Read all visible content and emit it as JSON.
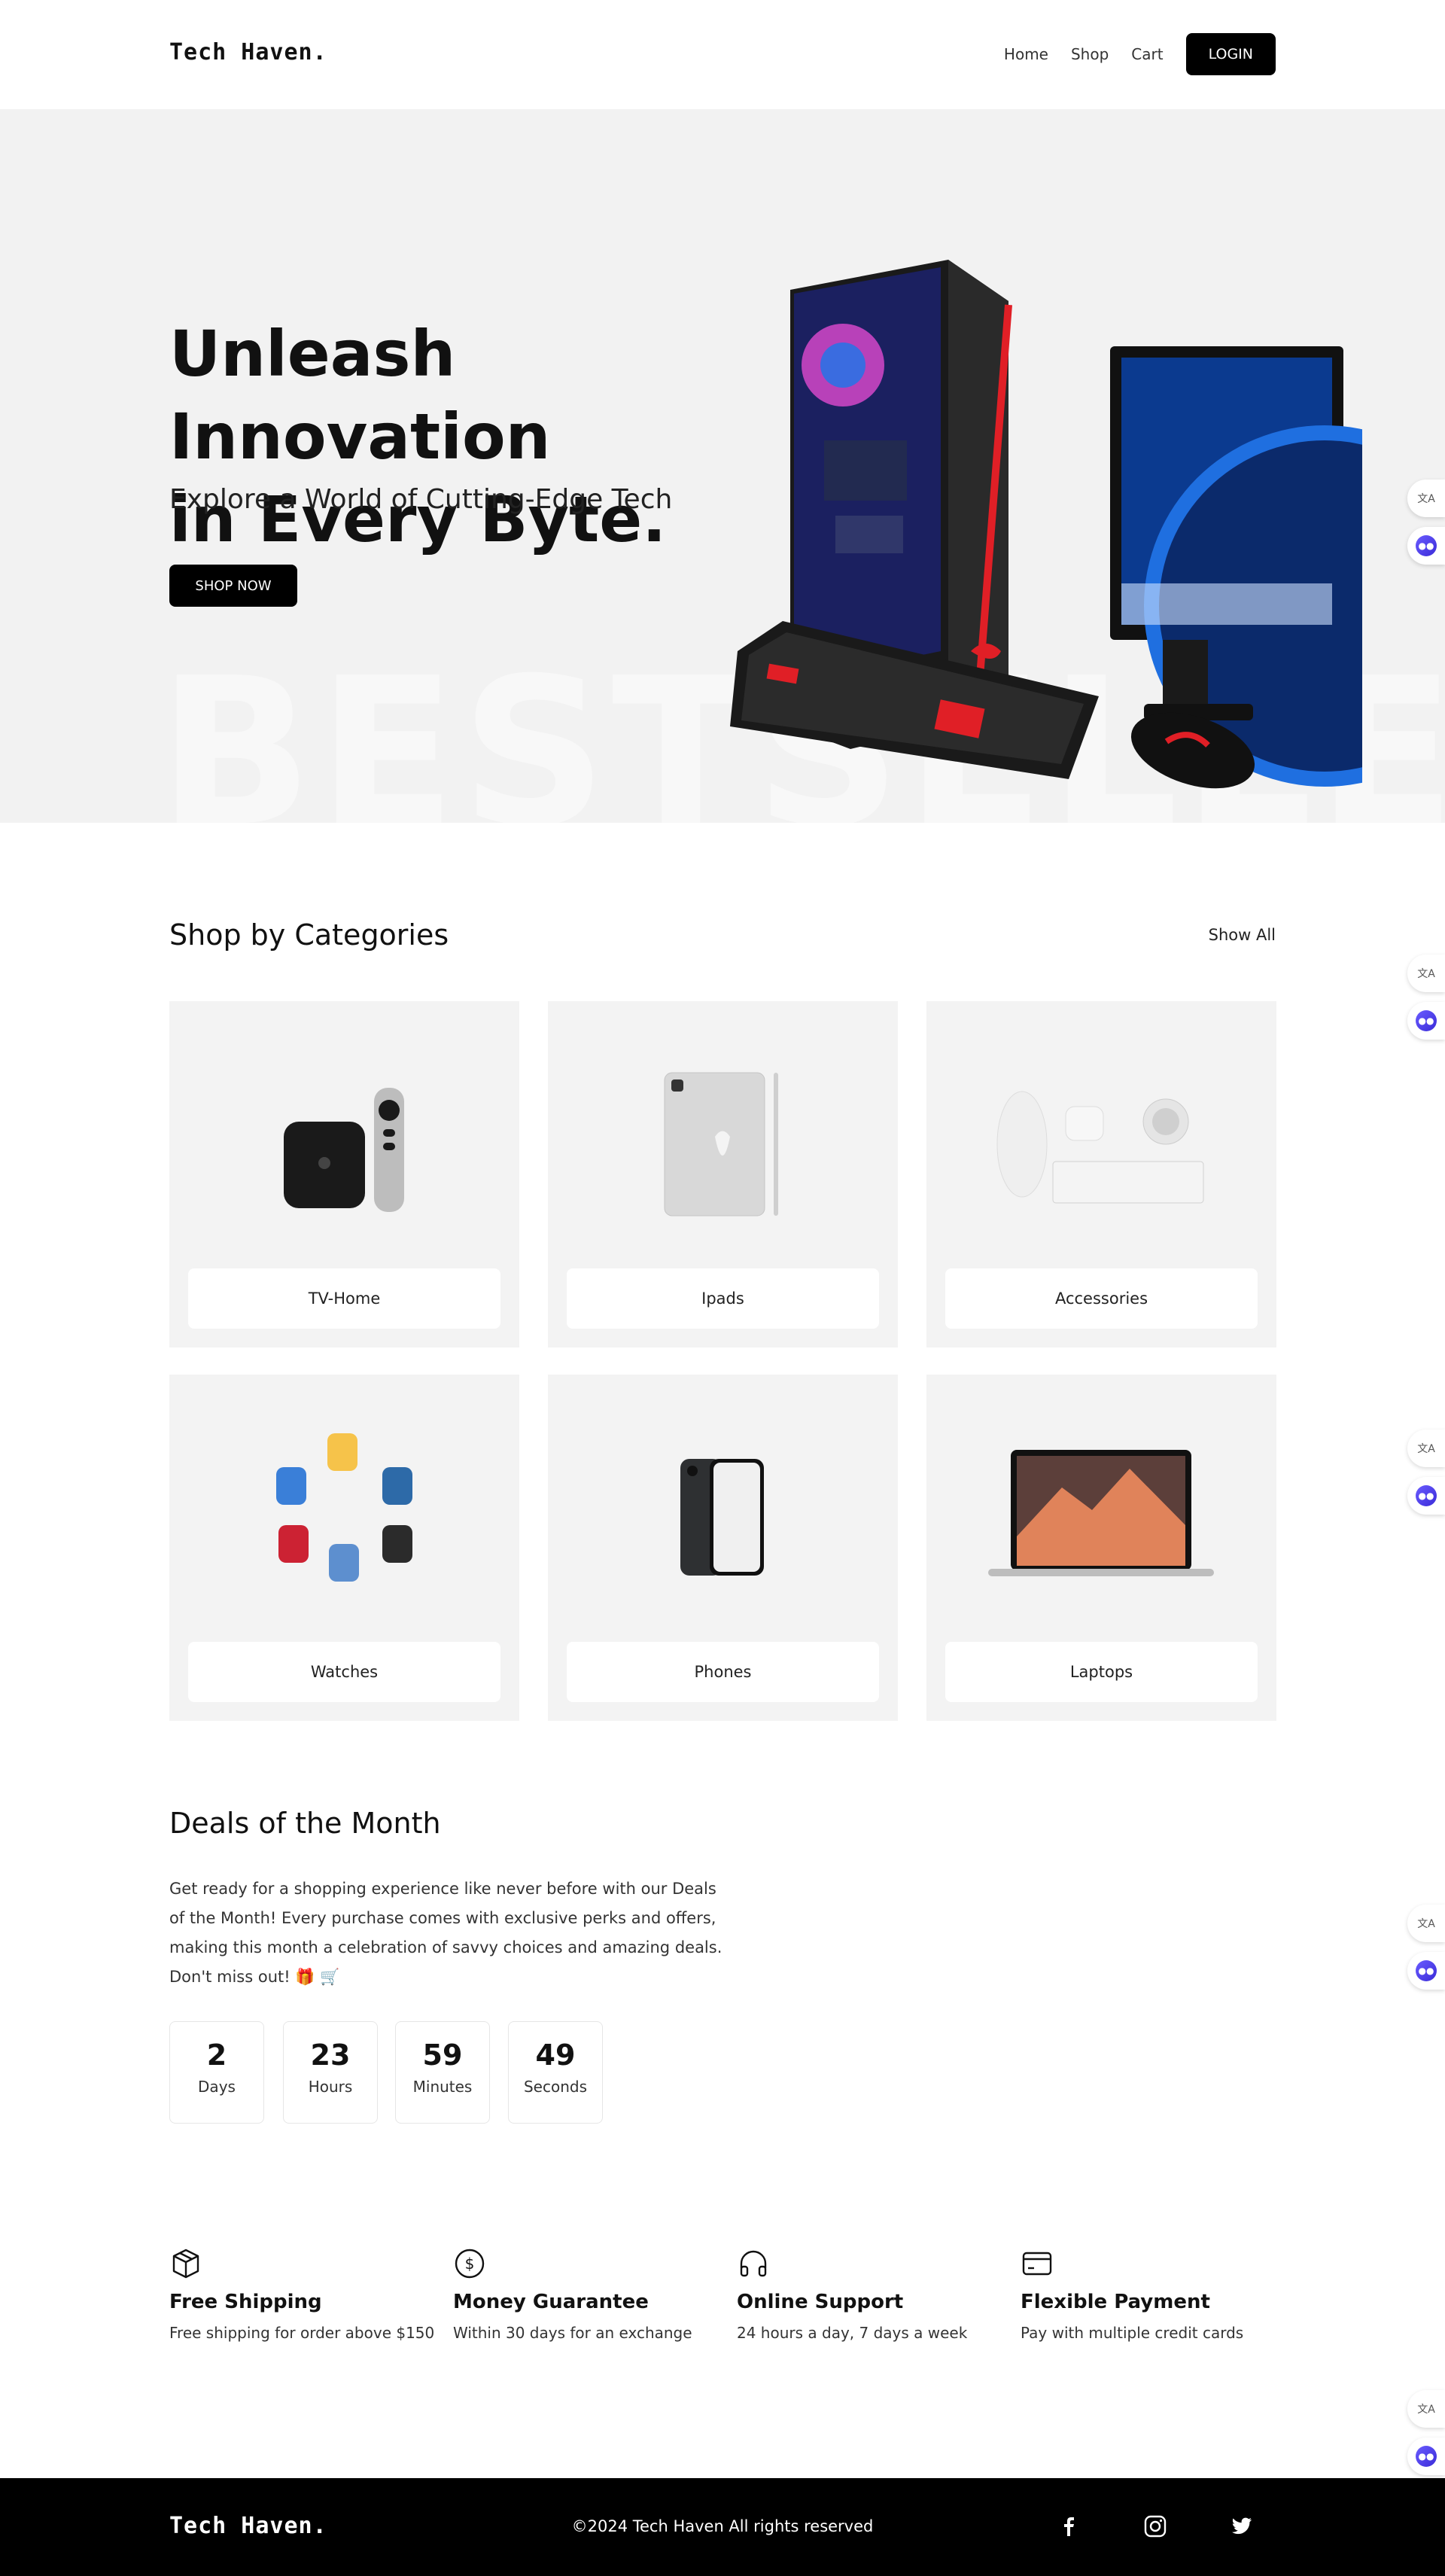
{
  "header": {
    "logo": "Tech Haven.",
    "nav": [
      "Home",
      "Shop",
      "Cart"
    ],
    "login": "LOGIN"
  },
  "hero": {
    "title_line1": "Unleash Innovation",
    "title_line2": "in Every Byte.",
    "subtitle": "Explore a World of Cutting-Edge Tech",
    "button": "SHOP NOW",
    "background_word": "BESTSELLER"
  },
  "categories": {
    "title": "Shop by Categories",
    "show_all": "Show All",
    "items": [
      {
        "label": "TV-Home",
        "icon": "apple-tv-icon"
      },
      {
        "label": "Ipads",
        "icon": "ipad-icon"
      },
      {
        "label": "Accessories",
        "icon": "accessories-icon"
      },
      {
        "label": "Watches",
        "icon": "watches-icon"
      },
      {
        "label": "Phones",
        "icon": "iphone-icon"
      },
      {
        "label": "Laptops",
        "icon": "laptop-icon"
      }
    ]
  },
  "deals": {
    "title": "Deals of the Month",
    "text": "Get ready for a shopping experience like never before with our Deals of the Month! Every purchase comes with exclusive perks and offers, making this month a celebration of savvy choices and amazing deals. Don't miss out! 🎁 🛒",
    "timer": [
      {
        "value": "2",
        "unit": "Days"
      },
      {
        "value": "23",
        "unit": "Hours"
      },
      {
        "value": "59",
        "unit": "Minutes"
      },
      {
        "value": "49",
        "unit": "Seconds"
      }
    ]
  },
  "features": [
    {
      "title": "Free Shipping",
      "desc": "Free shipping for order above $150",
      "icon": "box-icon"
    },
    {
      "title": "Money Guarantee",
      "desc": "Within 30 days for an exchange",
      "icon": "dollar-icon"
    },
    {
      "title": "Online Support",
      "desc": "24 hours a day, 7 days a week",
      "icon": "headphones-icon"
    },
    {
      "title": "Flexible Payment",
      "desc": "Pay with multiple credit cards",
      "icon": "credit-card-icon"
    }
  ],
  "footer": {
    "logo": "Tech Haven.",
    "copyright": "©2024 Tech Haven All rights reserved",
    "social": [
      "facebook-icon",
      "instagram-icon",
      "twitter-icon"
    ]
  },
  "colors": {
    "primary": "#000000",
    "hero_bg": "#f2f2f2",
    "card_bg": "#f3f3f3",
    "accent_red": "#e01f26"
  }
}
